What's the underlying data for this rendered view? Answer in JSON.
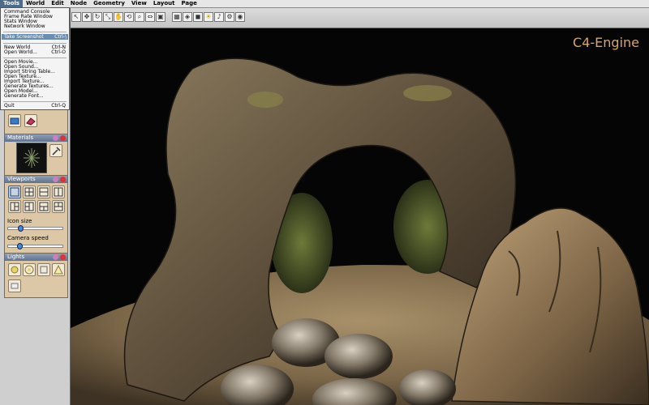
{
  "menubar": {
    "items": [
      "Tools",
      "World",
      "Edit",
      "Node",
      "Geometry",
      "View",
      "Layout",
      "Page"
    ]
  },
  "tools_menu": {
    "items": [
      {
        "label": "Command Console",
        "shortcut": ""
      },
      {
        "label": "Frame Rate Window",
        "shortcut": ""
      },
      {
        "label": "Stats Window",
        "shortcut": ""
      },
      {
        "label": "Network Window",
        "shortcut": ""
      },
      {
        "label": "Take Screenshot",
        "shortcut": "Ctrl-\\",
        "highlighted": true
      },
      {
        "label": "New World",
        "shortcut": "Ctrl-N"
      },
      {
        "label": "Open World...",
        "shortcut": "Ctrl-O"
      },
      {
        "label": "Open Movie...",
        "shortcut": ""
      },
      {
        "label": "Open Sound...",
        "shortcut": ""
      },
      {
        "label": "Import String Table...",
        "shortcut": ""
      },
      {
        "label": "Open Texture...",
        "shortcut": ""
      },
      {
        "label": "Import Texture...",
        "shortcut": ""
      },
      {
        "label": "Generate Textures...",
        "shortcut": ""
      },
      {
        "label": "Open Model...",
        "shortcut": ""
      },
      {
        "label": "Generate Font...",
        "shortcut": ""
      },
      {
        "label": "Quit",
        "shortcut": "Ctrl-Q"
      }
    ]
  },
  "panels": {
    "materials": {
      "title": "Materials"
    },
    "viewports": {
      "title": "Viewports",
      "icon_size_label": "Icon size",
      "camera_speed_label": "Camera speed",
      "icon_size_value": 0.2,
      "camera_speed_value": 0.18
    },
    "lights": {
      "title": "Lights"
    }
  },
  "viewport": {
    "engine_label": "C4-Engine"
  },
  "colors": {
    "accent": "#d9a561",
    "menu_highlight": "#6b8db0",
    "panel_bg": "#dcc8a6"
  }
}
